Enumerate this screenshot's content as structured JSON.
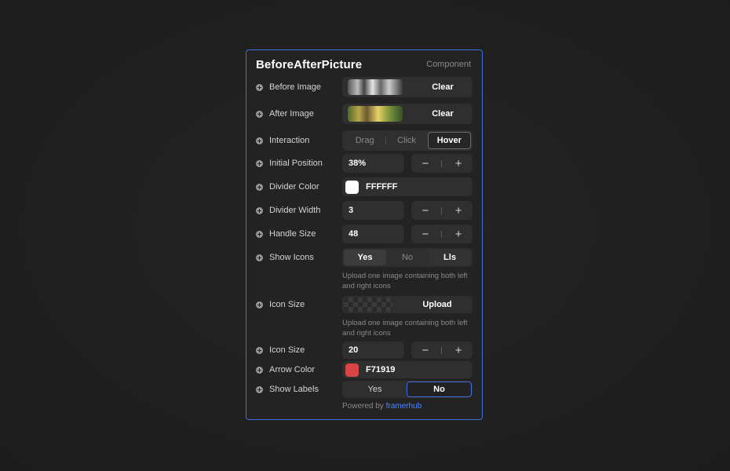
{
  "panel": {
    "title": "BeforeAfterPicture",
    "kind": "Component"
  },
  "rows": {
    "before_image": {
      "label": "Before Image",
      "action": "Clear"
    },
    "after_image": {
      "label": "After Image",
      "action": "Clear"
    },
    "interaction": {
      "label": "Interaction",
      "options": [
        "Drag",
        "Click",
        "Hover"
      ],
      "selected": "Hover"
    },
    "initial_position": {
      "label": "Initial Position",
      "value": "38%"
    },
    "divider_color": {
      "label": "Divider Color",
      "value": "FFFFFF",
      "color": "#FFFFFF"
    },
    "divider_width": {
      "label": "Divider Width",
      "value": "3"
    },
    "handle_size": {
      "label": "Handle Size",
      "value": "48"
    },
    "show_icons": {
      "label": "Show Icons",
      "options": [
        "Yes",
        "No",
        "Lls"
      ],
      "selected": "Yes"
    },
    "icons_hint": "Upload one image containing both left and right icons",
    "icon_upload": {
      "label": "Icon Size",
      "action": "Upload"
    },
    "upload_hint": "Upload one image containing both left and right icons",
    "icon_size": {
      "label": "Icon Size",
      "value": "20"
    },
    "arrow_color": {
      "label": "Arrow Color",
      "value": "F71919",
      "color": "#D94545"
    },
    "show_labels": {
      "label": "Show Labels",
      "options": [
        "Yes",
        "No"
      ],
      "selected": "No"
    }
  },
  "stepper": {
    "minus": "−",
    "plus": "+"
  },
  "footer": {
    "prefix": "Powered by",
    "link": "framerhub"
  },
  "colors": {
    "accent": "#3D6FE0",
    "link": "#4F86FF"
  }
}
